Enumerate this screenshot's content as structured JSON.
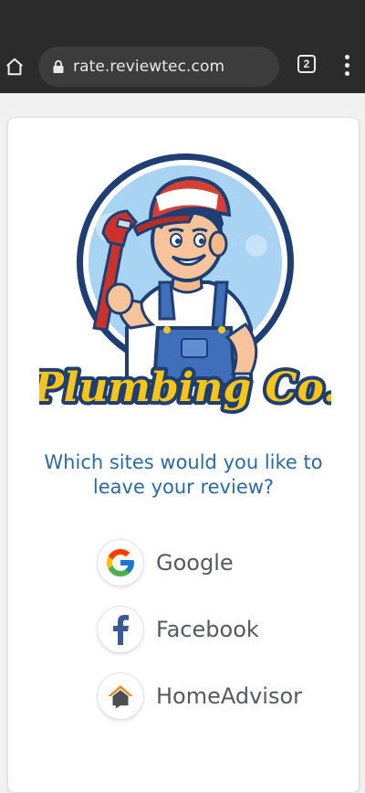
{
  "browser": {
    "url": "rate.reviewtec.com",
    "tab_count": "2"
  },
  "page": {
    "brand_name": "Plumbing Co.",
    "question_line1": "Which sites would you like to",
    "question_line2": "leave your review?",
    "options": [
      {
        "label": "Google",
        "icon": "google-icon"
      },
      {
        "label": "Facebook",
        "icon": "facebook-icon"
      },
      {
        "label": "HomeAdvisor",
        "icon": "homeadvisor-icon"
      }
    ]
  },
  "colors": {
    "toolbar_bg": "#2b2b2b",
    "question_text": "#2a6aa6",
    "option_text": "#555a62"
  }
}
